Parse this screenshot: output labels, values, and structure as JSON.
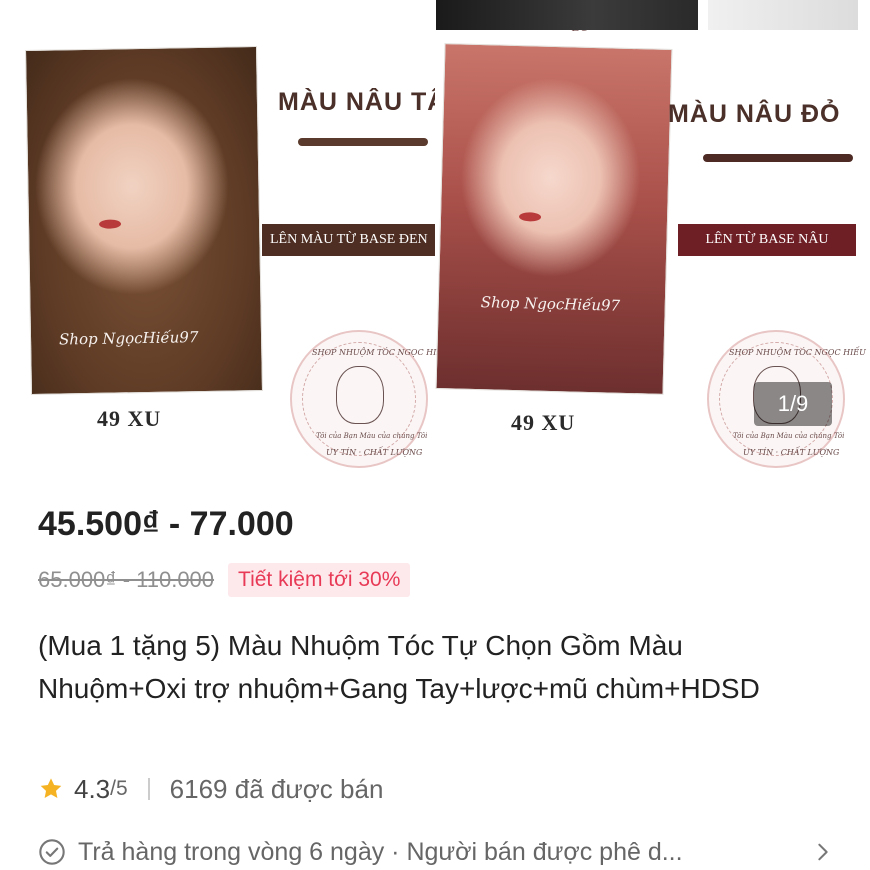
{
  "gallery": {
    "left_panel": {
      "title": "MÀU NÂU TÂY",
      "banner": "LÊN MÀU TỪ BASE ĐEN",
      "watermark": "Shop NgọcHiếu97",
      "price_label": "49 XU"
    },
    "right_panel": {
      "title": "MÀU NÂU ĐỎ",
      "banner": "LÊN TỪ BASE NÂU",
      "watermark": "Shop NgọcHiếu97",
      "price_label": "49 XU"
    },
    "seal": {
      "ring_text": "SHOP NHUỘM TÓC NGỌC HIẾU",
      "inner_text": "Tôi của Bạn Màu của chúng Tôi",
      "bottom_text": "UY TÍN · CHẤT LƯỢNG"
    },
    "counter": "1/9"
  },
  "product": {
    "price_range": "45.500₫ - 77.000",
    "original_price": "65.000₫ - 110.000",
    "saving_badge": "Tiết kiệm tới 30%",
    "title": "(Mua 1 tặng 5) Màu Nhuộm Tóc Tự Chọn Gồm Màu Nhuộm+Oxi trợ nhuộm+Gang Tay+lược+mũ chùm+HDSD",
    "rating": {
      "value": "4.3",
      "max": "/5",
      "sold": "6169 đã được bán"
    },
    "policy": "Trả hàng trong vòng 6 ngày · Người bán được phê d..."
  },
  "colors": {
    "accent": "#e83a56",
    "accent_bg": "#fde9ec",
    "star": "#f5b323",
    "brown_banner": "#4e2e22",
    "red_banner": "#6e1f26"
  },
  "icons": {
    "star": "star-icon",
    "policy": "check-circle-icon",
    "more": "chevron-right-icon"
  }
}
